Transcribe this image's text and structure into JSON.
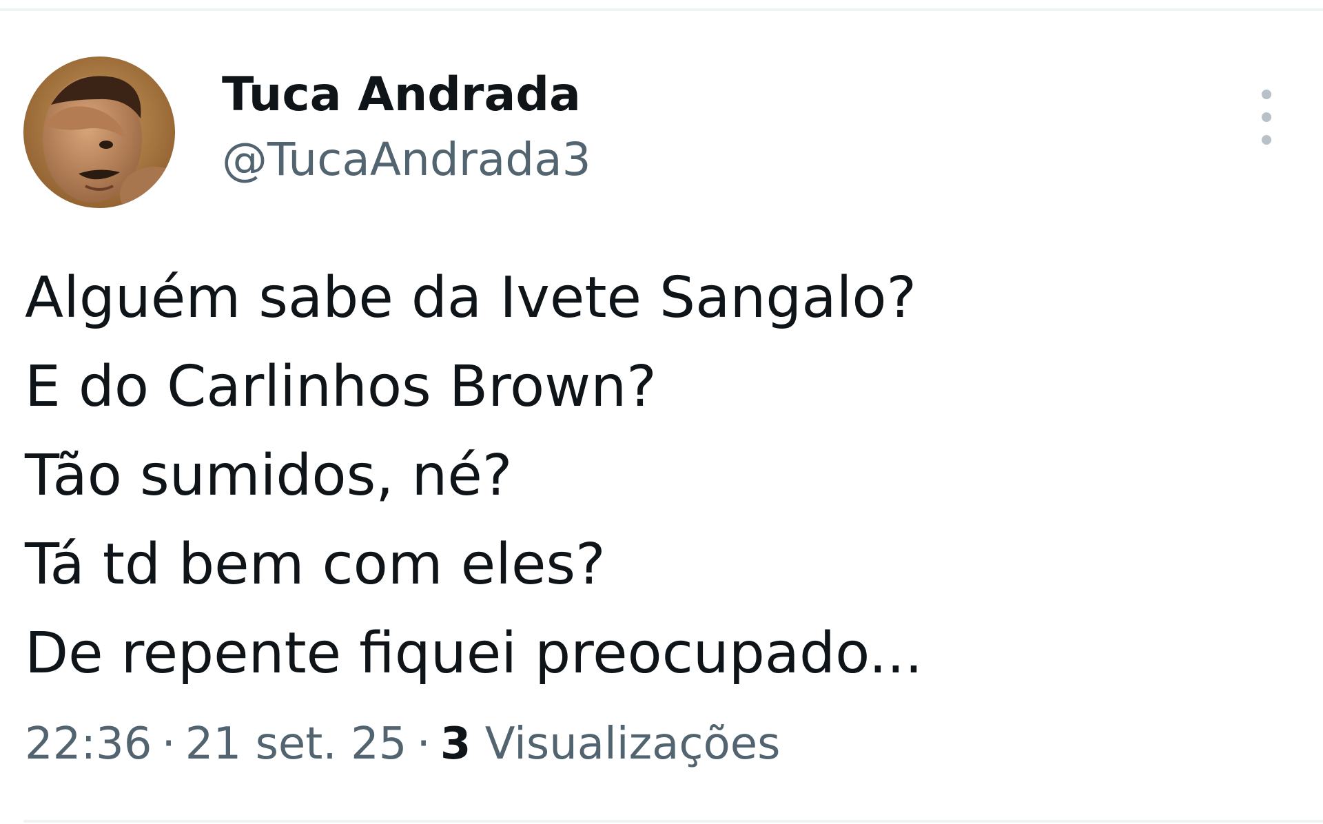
{
  "tweet": {
    "author": {
      "display_name": "Tuca Andrada",
      "handle": "@TucaAndrada3",
      "avatar_icon": "profile-photo"
    },
    "more_icon": "more-vertical-icon",
    "text_lines": [
      "Alguém sabe da Ivete Sangalo?",
      "E do Carlinhos Brown?",
      "Tão sumidos, né?",
      "Tá td bem com eles?",
      "De repente fiquei preocupado..."
    ],
    "meta": {
      "time": "22:36",
      "separator": "·",
      "date": "21 set. 25",
      "views_count": "3",
      "views_label": "Visualizações"
    }
  },
  "colors": {
    "text_primary": "#0f1419",
    "text_secondary": "#536471",
    "divider": "#eff3f4",
    "more_dots": "#b9c1c8"
  }
}
